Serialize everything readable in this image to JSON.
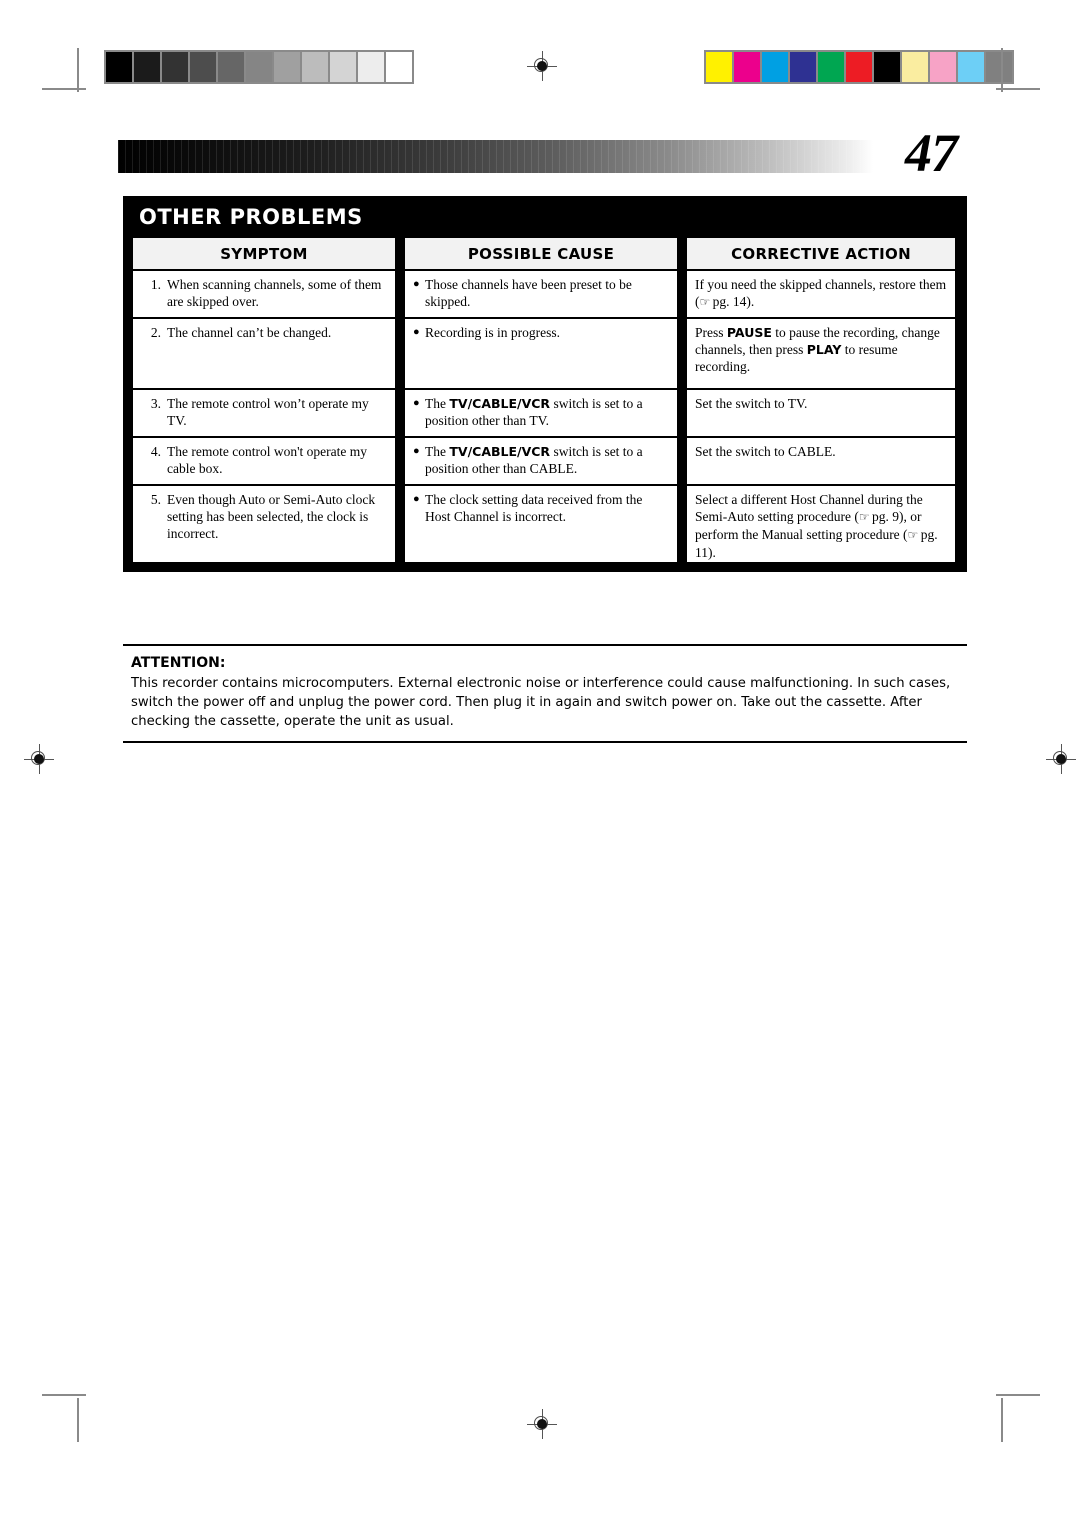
{
  "page": {
    "number": "47"
  },
  "calibration": {
    "grayscale_label": "grayscale-calibration-bar",
    "grayscale_swatches": [
      "#000000",
      "#1b1b1b",
      "#333333",
      "#4d4d4d",
      "#666666",
      "#858585",
      "#a0a0a0",
      "#bcbcbc",
      "#d4d4d4",
      "#ededed",
      "#ffffff"
    ],
    "color_label": "color-calibration-bar",
    "color_swatches": [
      "#fff100",
      "#ec008c",
      "#00a0e3",
      "#2e3192",
      "#00a651",
      "#ed1c24",
      "#000000",
      "#faeda0",
      "#f7a3c6",
      "#6dcff6",
      "#808080"
    ]
  },
  "panel": {
    "title": "OTHER PROBLEMS",
    "headers": [
      "SYMPTOM",
      "POSSIBLE CAUSE",
      "CORRECTIVE ACTION"
    ],
    "rows": [
      {
        "number": "1.",
        "symptom": "When scanning channels, some of them are skipped over.",
        "cause_bullet": "●",
        "cause": "Those channels have been preset to be skipped.",
        "action_parts": [
          {
            "type": "text",
            "text": "If you need the skipped channels, restore them ("
          },
          {
            "type": "hand",
            "text": "☞"
          },
          {
            "type": "text",
            "text": " pg. 14)."
          }
        ]
      },
      {
        "number": "2.",
        "symptom": "The channel can’t be changed.",
        "cause_bullet": "●",
        "cause": "Recording is in progress.",
        "action_parts": [
          {
            "type": "text",
            "text": "Press "
          },
          {
            "type": "bold",
            "text": "PAUSE"
          },
          {
            "type": "text",
            "text": " to pause the recording, change channels, then press "
          },
          {
            "type": "bold",
            "text": "PLAY"
          },
          {
            "type": "text",
            "text": " to resume recording."
          }
        ]
      },
      {
        "number": "3.",
        "symptom": "The remote control won’t operate my TV.",
        "cause_bullet": "●",
        "cause_parts": [
          {
            "type": "text",
            "text": "The "
          },
          {
            "type": "bold",
            "text": "TV/CABLE/VCR"
          },
          {
            "type": "text",
            "text": " switch is set to a position other than TV."
          }
        ],
        "action_parts": [
          {
            "type": "text",
            "text": "Set the switch to TV."
          }
        ]
      },
      {
        "number": "4.",
        "symptom": "The remote control won't operate my cable box.",
        "cause_bullet": "●",
        "cause_parts": [
          {
            "type": "text",
            "text": "The "
          },
          {
            "type": "bold",
            "text": "TV/CABLE/VCR"
          },
          {
            "type": "text",
            "text": " switch is set to a position other than CABLE."
          }
        ],
        "action_parts": [
          {
            "type": "text",
            "text": "Set the switch to CABLE."
          }
        ]
      },
      {
        "number": "5.",
        "symptom": "Even though Auto or Semi-Auto clock setting has been selected, the clock is incorrect.",
        "cause_bullet": "●",
        "cause": "The clock setting data received from the Host Channel is incorrect.",
        "action_parts": [
          {
            "type": "text",
            "text": "Select a different Host Channel during the Semi-Auto setting procedure ("
          },
          {
            "type": "hand",
            "text": "☞"
          },
          {
            "type": "text",
            "text": " pg. 9), or perform the Manual setting procedure ("
          },
          {
            "type": "hand",
            "text": "☞"
          },
          {
            "type": "text",
            "text": " pg. 11)."
          }
        ]
      }
    ]
  },
  "attention": {
    "title": "ATTENTION:",
    "body": "This recorder contains microcomputers. External electronic noise or interference could cause malfunctioning. In such cases, switch the power off and unplug the power cord. Then plug it in again and switch power on. Take out the cassette. After checking the cassette, operate the unit as usual."
  }
}
